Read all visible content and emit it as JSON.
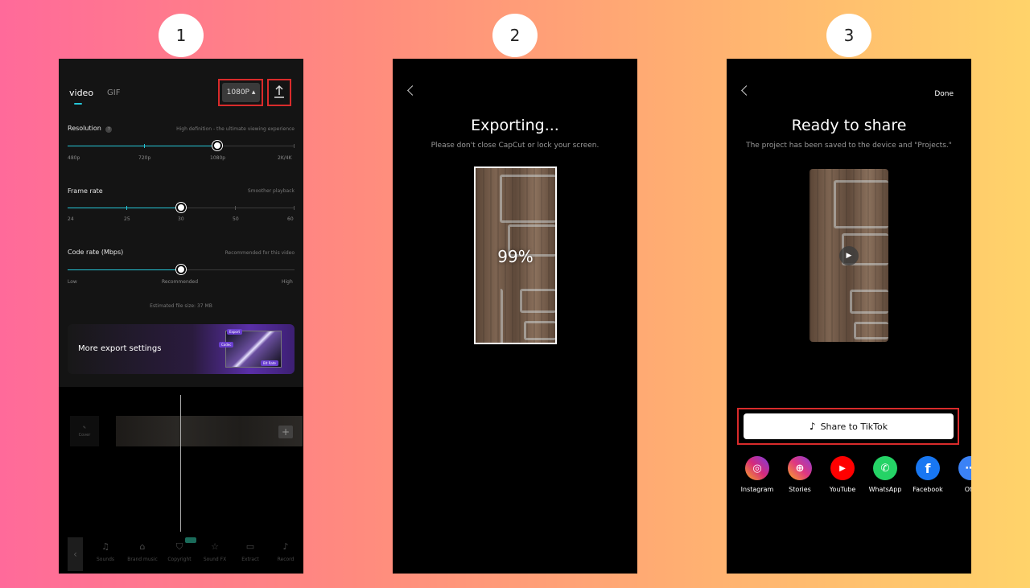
{
  "steps": [
    "1",
    "2",
    "3"
  ],
  "export_settings": {
    "tabs": {
      "video": "video",
      "gif": "GIF"
    },
    "resolution_button": "1080P ▴",
    "upload_icon": "upload-icon",
    "resolution": {
      "label": "Resolution",
      "hint": "High definition - the ultimate viewing experience",
      "ticks": [
        "480p",
        "720p",
        "1080p",
        "2K/4K"
      ],
      "selected": "1080p"
    },
    "frame_rate": {
      "label": "Frame rate",
      "hint": "Smoother playback",
      "ticks": [
        "24",
        "25",
        "30",
        "50",
        "60"
      ],
      "selected": "30"
    },
    "code_rate": {
      "label": "Code rate (Mbps)",
      "hint": "Recommended for this video",
      "ticks": [
        "Low",
        "Recommended",
        "High"
      ],
      "selected": "Recommended"
    },
    "estimated_size": "Estimated file size: 37 MB",
    "more_settings": "More export settings",
    "card_tags": {
      "export": "Export",
      "codec": "Codec",
      "bitrate": "Bit Rate"
    },
    "timeline": {
      "cover": "Cover"
    },
    "toolbar": [
      {
        "label": "Sounds",
        "icon": "♫"
      },
      {
        "label": "Brand music",
        "icon": "⌂"
      },
      {
        "label": "Copyright",
        "icon": "⛉"
      },
      {
        "label": "Sound FX",
        "icon": "☆"
      },
      {
        "label": "Extract",
        "icon": "▭"
      },
      {
        "label": "Record",
        "icon": "♪"
      }
    ]
  },
  "exporting": {
    "title": "Exporting...",
    "subtitle": "Please don't close CapCut or lock your screen.",
    "progress": "99%"
  },
  "ready": {
    "done": "Done",
    "title": "Ready to share",
    "subtitle": "The project has been saved to the device and \"Projects.\"",
    "share_tiktok": "Share to TikTok",
    "share_targets": [
      {
        "label": "Instagram",
        "color": "#d6297a"
      },
      {
        "label": "Stories",
        "color": "#e0387f"
      },
      {
        "label": "YouTube",
        "color": "#ff0000"
      },
      {
        "label": "WhatsApp",
        "color": "#25d366"
      },
      {
        "label": "Facebook",
        "color": "#1877f2"
      },
      {
        "label": "Oth",
        "color": "#3b82f6"
      }
    ]
  },
  "colors": {
    "accent": "#25c6d8",
    "highlight": "#d92b2b"
  }
}
